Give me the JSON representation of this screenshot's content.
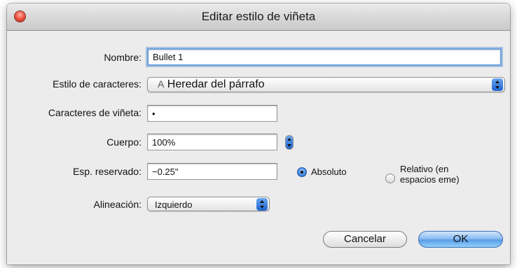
{
  "window": {
    "title": "Editar estilo de viñeta"
  },
  "form": {
    "nombre": {
      "label": "Nombre:",
      "value": "Bullet 1"
    },
    "estilo_caracteres": {
      "label": "Estilo de caracteres:",
      "selected": "Heredar del párrafo",
      "icon": "character-style-icon"
    },
    "caracteres_vineta": {
      "label": "Caracteres de viñeta:",
      "value": "•"
    },
    "cuerpo": {
      "label": "Cuerpo:",
      "value": "100%"
    },
    "esp_reservado": {
      "label": "Esp. reservado:",
      "value": "−0.25\""
    },
    "alineacion": {
      "label": "Alineación:",
      "selected": "Izquierdo"
    }
  },
  "spacing_mode": {
    "options": [
      {
        "label": "Absoluto",
        "selected": true
      },
      {
        "label": "Relativo (en espacios eme)",
        "line1": "Relativo (en",
        "line2": "espacios eme)",
        "selected": false
      }
    ]
  },
  "buttons": {
    "cancel_label": "Cancelar",
    "ok_label": "OK"
  },
  "colors": {
    "accent": "#3d84de",
    "close_button": "#f05a4a"
  }
}
